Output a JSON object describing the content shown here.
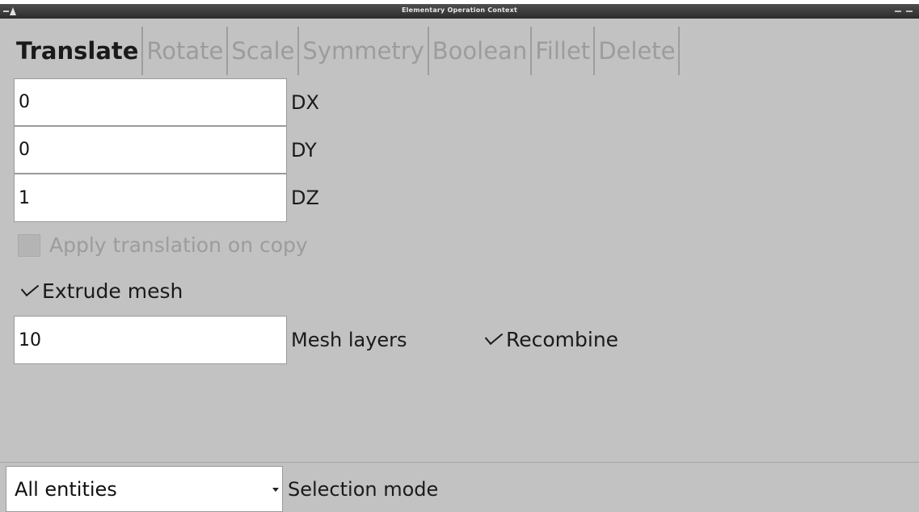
{
  "window": {
    "title": "Elementary Operation Context"
  },
  "tabs": [
    {
      "label": "Translate",
      "active": true
    },
    {
      "label": "Rotate",
      "active": false
    },
    {
      "label": "Scale",
      "active": false
    },
    {
      "label": "Symmetry",
      "active": false
    },
    {
      "label": "Boolean",
      "active": false
    },
    {
      "label": "Fillet",
      "active": false
    },
    {
      "label": "Delete",
      "active": false
    }
  ],
  "translate": {
    "dx": {
      "value": "0",
      "label": "DX"
    },
    "dy": {
      "value": "0",
      "label": "DY"
    },
    "dz": {
      "value": "1",
      "label": "DZ"
    },
    "apply_on_copy": {
      "label": "Apply translation on copy",
      "checked": false,
      "enabled": false
    },
    "extrude_mesh": {
      "label": "Extrude mesh",
      "checked": true
    },
    "mesh_layers": {
      "value": "10",
      "label": "Mesh layers"
    },
    "recombine": {
      "label": "Recombine",
      "checked": true
    }
  },
  "selection": {
    "value": "All entities",
    "label": "Selection mode"
  }
}
